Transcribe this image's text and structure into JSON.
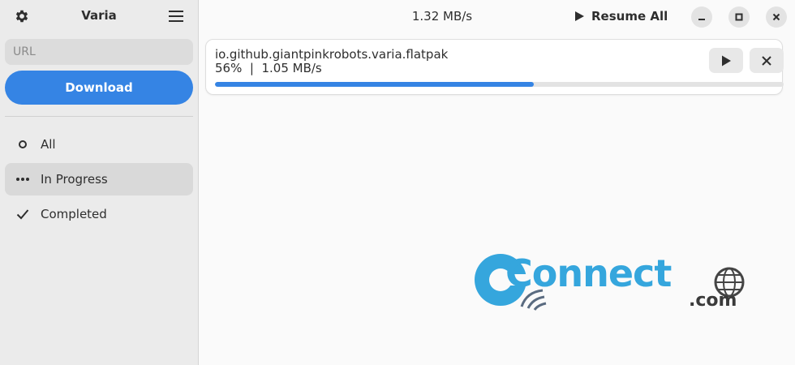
{
  "app": {
    "title": "Varia"
  },
  "sidebar": {
    "url_placeholder": "URL",
    "download_label": "Download",
    "filters": [
      {
        "label": "All",
        "icon": "circle-icon",
        "active": false
      },
      {
        "label": "In Progress",
        "icon": "dots-icon",
        "active": true
      },
      {
        "label": "Completed",
        "icon": "checkmark-icon",
        "active": false
      }
    ]
  },
  "header": {
    "total_speed": "1.32 MB/s",
    "resume_all_label": "Resume All"
  },
  "downloads": [
    {
      "filename": "io.github.giantpinkrobots.varia.flatpak",
      "status": "56%  |  1.05 MB/s",
      "progress": 0.56
    }
  ],
  "watermark": {
    "word": "Connect",
    "suffix": ".com"
  },
  "colors": {
    "accent": "#3584e4",
    "watermark_blue": "#35a6dd"
  }
}
